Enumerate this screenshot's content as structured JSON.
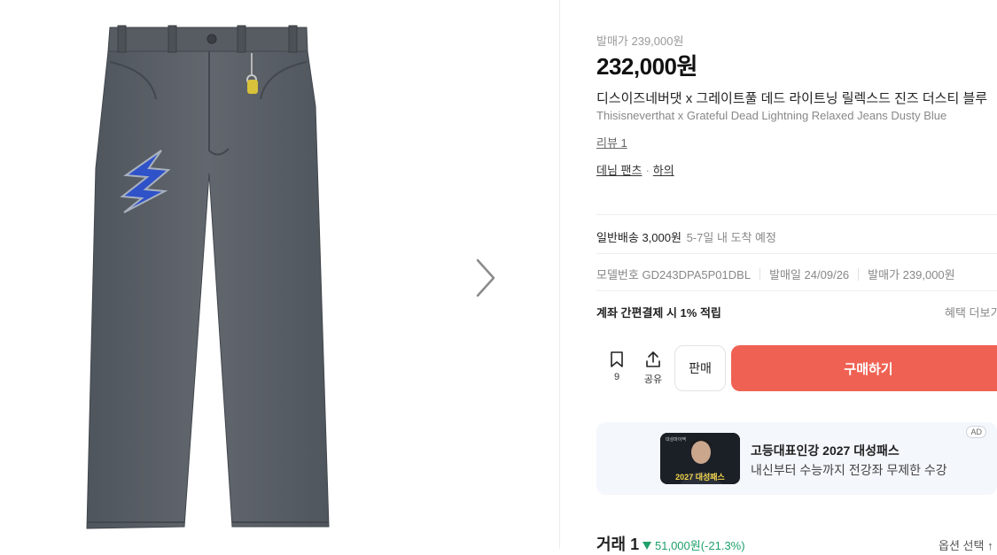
{
  "product": {
    "release_price_top": "발매가 239,000원",
    "price": "232,000원",
    "name_ko": "디스이즈네버댓 x 그레이트풀 데드 라이트닝 릴렉스드 진즈 더스티 블루",
    "name_en": "Thisisneverthat x Grateful Dead Lightning Relaxed Jeans Dusty Blue",
    "review": "리뷰 1",
    "categories": [
      "데님 팬츠",
      "하의"
    ],
    "category_sep": "·"
  },
  "shipping": {
    "label": "일반배송 3,000원",
    "eta": "5-7일 내 도착 예정"
  },
  "meta": {
    "model": "모델번호 GD243DPA5P01DBL",
    "release_date": "발매일 24/09/26",
    "release_price": "발매가 239,000원"
  },
  "benefit": {
    "label": "계좌 간편결제 시 1% 적립",
    "more": "혜택 더보기"
  },
  "actions": {
    "bookmark_count": "9",
    "share_label": "공유",
    "sell_label": "판매",
    "buy_label": "구매하기"
  },
  "ad": {
    "badge": "AD",
    "title": "고등대표인강 2027 대성패스",
    "desc": "내신부터 수능까지 전강좌 무제한 수강",
    "thumb_text": "2027 대성패스",
    "thumb_brand": "대성마이맥"
  },
  "trade": {
    "label": "거래 1",
    "change": "51,000원(-21.3%)",
    "option_select": "옵션 선택 ↑"
  },
  "colors": {
    "buy": "#ef6253",
    "down": "#1fa06b",
    "denim": "#5b6168",
    "patch": "#2f52c9"
  },
  "icons": [
    "chevron-right-icon",
    "bookmark-icon",
    "share-icon"
  ]
}
